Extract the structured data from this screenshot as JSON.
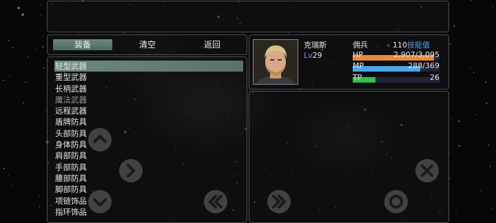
{
  "tabs": {
    "equip": "装备",
    "clear": "清空",
    "back": "返回"
  },
  "categories": [
    {
      "label": "轻型武器",
      "selected": true
    },
    {
      "label": "重型武器"
    },
    {
      "label": "长柄武器"
    },
    {
      "label": "魔法武器",
      "dim": true
    },
    {
      "label": "远程武器"
    },
    {
      "label": "盾牌防具"
    },
    {
      "label": "头部防具"
    },
    {
      "label": "身体防具"
    },
    {
      "label": "肩部防具"
    },
    {
      "label": "手部防具"
    },
    {
      "label": "腰部防具"
    },
    {
      "label": "脚部防具"
    },
    {
      "label": "项链饰品"
    },
    {
      "label": "指环饰品"
    }
  ],
  "character": {
    "name": "克瑞斯",
    "class": "佣兵",
    "skill_points": "110",
    "skill_label": "技能值",
    "level_label": "Lv",
    "level": "29",
    "hp_label": "HP",
    "hp_value": "2,907/3,095",
    "hp_ratio": 0.939,
    "mp_label": "MP",
    "mp_value": "288/369",
    "mp_ratio": 0.78,
    "tp_label": "TP",
    "tp_value": "26",
    "tp_ratio": 0.26
  },
  "colors": {
    "hp": "#e88a3a",
    "mp": "#4aa8e8",
    "tp": "#2ec24a",
    "skill_label": "#4aa8e8",
    "level_label": "#6a9ae0"
  },
  "icons": [
    "chevron-up-icon",
    "chevron-right-icon",
    "chevron-down-icon",
    "double-chevron-left-icon",
    "double-chevron-right-icon",
    "close-icon",
    "circle-confirm-icon"
  ]
}
